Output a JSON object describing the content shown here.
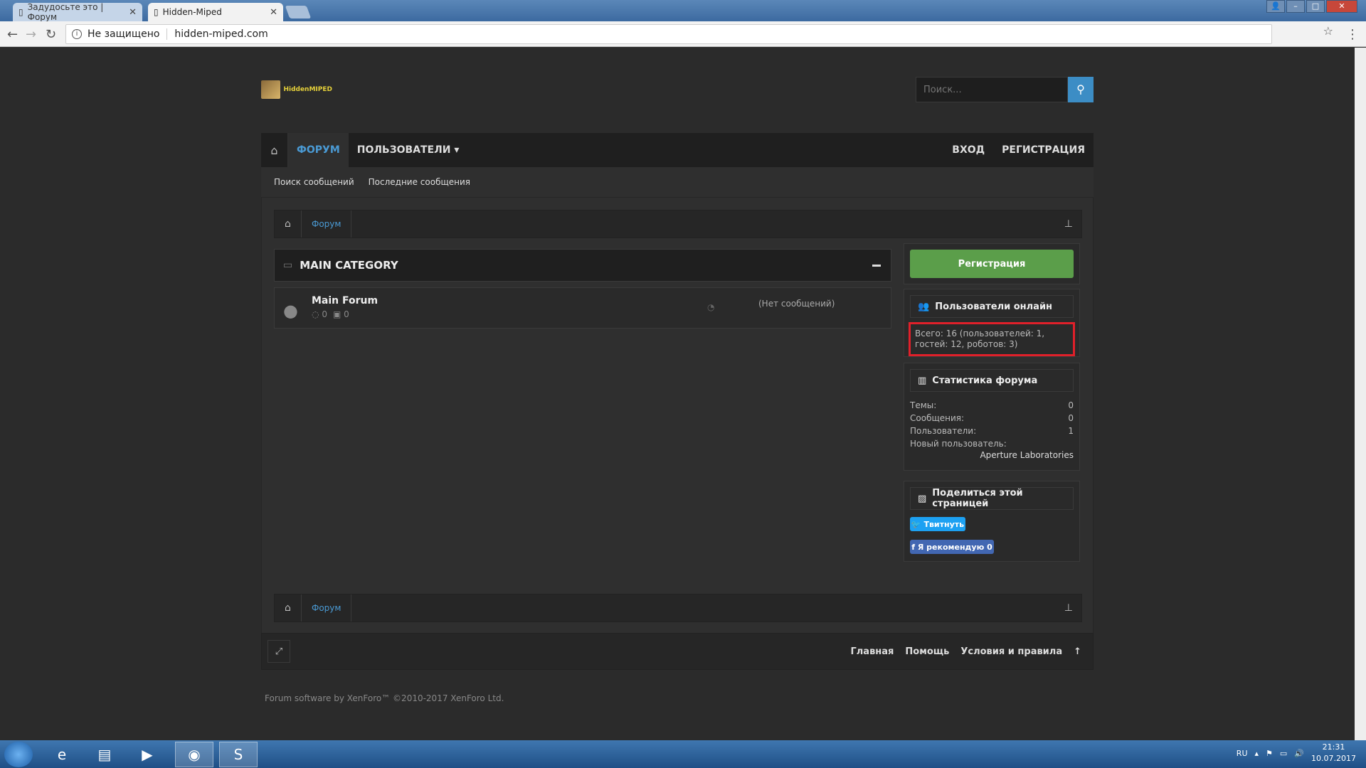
{
  "browser": {
    "tabs": [
      {
        "title": "Задудосьте это | Форум"
      },
      {
        "title": "Hidden-Miped"
      }
    ],
    "security_label": "Не защищено",
    "url": "hidden-miped.com"
  },
  "site": {
    "logo_text": "HiddenMIPED",
    "search_placeholder": "Поиск..."
  },
  "nav": {
    "forum": "ФОРУМ",
    "users": "ПОЛЬЗОВАТЕЛИ ▾",
    "login": "ВХОД",
    "register": "РЕГИСТРАЦИЯ"
  },
  "subnav": {
    "search_messages": "Поиск сообщений",
    "recent_messages": "Последние сообщения"
  },
  "breadcrumb": {
    "forum": "Форум"
  },
  "category": {
    "title": "MAIN CATEGORY",
    "forums": [
      {
        "name": "Main Forum",
        "threads": "0",
        "messages": "0",
        "last_post": "(Нет сообщений)"
      }
    ]
  },
  "sidebar": {
    "register_button": "Регистрация",
    "online_title": "Пользователи онлайн",
    "online_text": "Всего: 16 (пользователей: 1, гостей: 12, роботов: 3)",
    "stats_title": "Статистика форума",
    "stats": [
      {
        "label": "Темы:",
        "value": "0"
      },
      {
        "label": "Сообщения:",
        "value": "0"
      },
      {
        "label": "Пользователи:",
        "value": "1"
      }
    ],
    "new_user_label": "Новый пользователь:",
    "new_user_value": "Aperture Laboratories",
    "share_title": "Поделиться этой страницей",
    "tweet": "Твитнуть",
    "fb_like": "Я рекомендую 0"
  },
  "footer": {
    "links": [
      "Главная",
      "Помощь",
      "Условия и правила"
    ],
    "copyright": "Forum software by XenForo™ ©2010-2017 XenForo Ltd."
  },
  "taskbar": {
    "lang": "RU",
    "time": "21:31",
    "date": "10.07.2017"
  }
}
